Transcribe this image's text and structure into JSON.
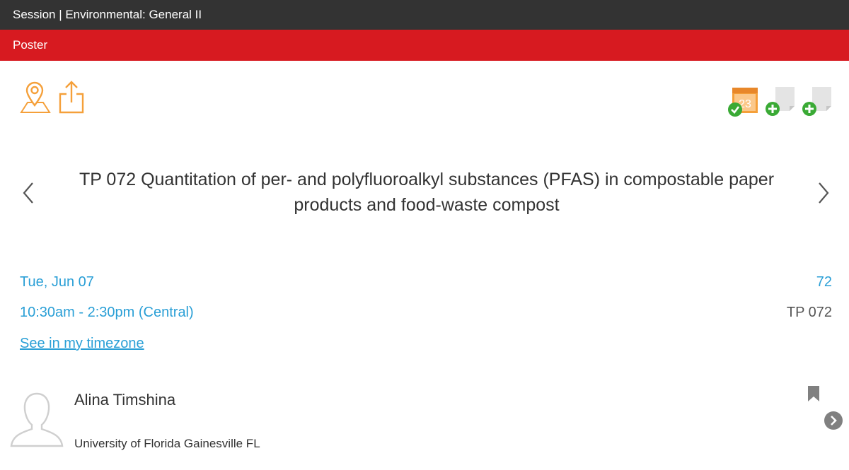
{
  "header": {
    "session_title": "Session | Environmental: General II",
    "type_label": "Poster"
  },
  "toolbar": {
    "left_icons": [
      "map-pin-icon",
      "share-icon"
    ],
    "right_icons": [
      "calendar-added-icon",
      "add-note-icon",
      "add-note-icon"
    ],
    "calendar_day": "23"
  },
  "presentation": {
    "title": "TP 072 Quantitation of per- and polyfluoroalkyl substances (PFAS) in compostable paper products and food-waste compost",
    "date": "Tue, Jun 07",
    "time": "10:30am - 2:30pm  (Central)",
    "timezone_link": "See in my timezone",
    "number": "72",
    "code": "TP 072"
  },
  "presenter": {
    "name": "Alina Timshina",
    "affiliation": "University of Florida Gainesville FL"
  },
  "colors": {
    "topbar": "#333333",
    "subbar": "#d71a20",
    "accent_orange": "#f5a03a",
    "link_blue": "#2a9fd6",
    "badge_green": "#3aaa35"
  }
}
